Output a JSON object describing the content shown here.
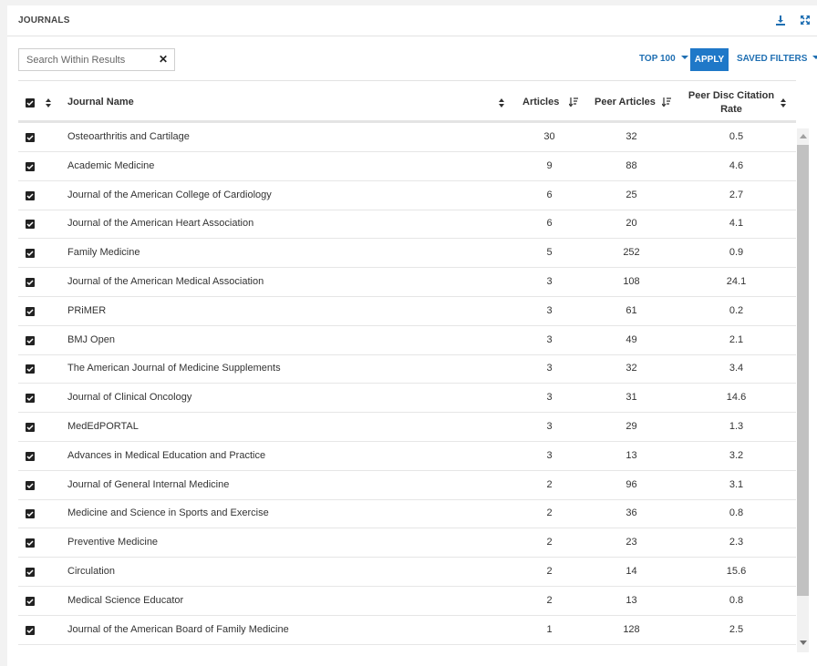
{
  "panel": {
    "title": "JOURNALS",
    "download_icon": "download-icon",
    "expand_icon": "expand-icon"
  },
  "toolbar": {
    "search_placeholder": "Search Within Results",
    "search_value": "",
    "clear_label": "✕",
    "top_label": "TOP 100",
    "apply_label": "APPLY",
    "saved_filters_label": "SAVED FILTERS"
  },
  "table": {
    "headers": {
      "journal": "Journal Name",
      "articles": "Articles",
      "peer_articles": "Peer Articles",
      "rate_line1": "Peer Disc Citation",
      "rate_line2": "Rate"
    },
    "rows": [
      {
        "name": "Osteoarthritis and Cartilage",
        "articles": "30",
        "peer": "32",
        "rate": "0.5"
      },
      {
        "name": "Academic Medicine",
        "articles": "9",
        "peer": "88",
        "rate": "4.6"
      },
      {
        "name": "Journal of the American College of Cardiology",
        "articles": "6",
        "peer": "25",
        "rate": "2.7"
      },
      {
        "name": "Journal of the American Heart Association",
        "articles": "6",
        "peer": "20",
        "rate": "4.1"
      },
      {
        "name": "Family Medicine",
        "articles": "5",
        "peer": "252",
        "rate": "0.9"
      },
      {
        "name": "Journal of the American Medical Association",
        "articles": "3",
        "peer": "108",
        "rate": "24.1"
      },
      {
        "name": "PRiMER",
        "articles": "3",
        "peer": "61",
        "rate": "0.2"
      },
      {
        "name": "BMJ Open",
        "articles": "3",
        "peer": "49",
        "rate": "2.1"
      },
      {
        "name": "The American Journal of Medicine Supplements",
        "articles": "3",
        "peer": "32",
        "rate": "3.4"
      },
      {
        "name": "Journal of Clinical Oncology",
        "articles": "3",
        "peer": "31",
        "rate": "14.6"
      },
      {
        "name": "MedEdPORTAL",
        "articles": "3",
        "peer": "29",
        "rate": "1.3"
      },
      {
        "name": "Advances in Medical Education and Practice",
        "articles": "3",
        "peer": "13",
        "rate": "3.2"
      },
      {
        "name": "Journal of General Internal Medicine",
        "articles": "2",
        "peer": "96",
        "rate": "3.1"
      },
      {
        "name": "Medicine and Science in Sports and Exercise",
        "articles": "2",
        "peer": "36",
        "rate": "0.8"
      },
      {
        "name": "Preventive Medicine",
        "articles": "2",
        "peer": "23",
        "rate": "2.3"
      },
      {
        "name": "Circulation",
        "articles": "2",
        "peer": "14",
        "rate": "15.6"
      },
      {
        "name": "Medical Science Educator",
        "articles": "2",
        "peer": "13",
        "rate": "0.8"
      },
      {
        "name": "Journal of the American Board of Family Medicine",
        "articles": "1",
        "peer": "128",
        "rate": "2.5"
      }
    ]
  },
  "colors": {
    "accent": "#1f78c8",
    "link": "#1f6fb2",
    "checkbox": "#222222",
    "scroll_thumb": "#c1c1c1"
  }
}
